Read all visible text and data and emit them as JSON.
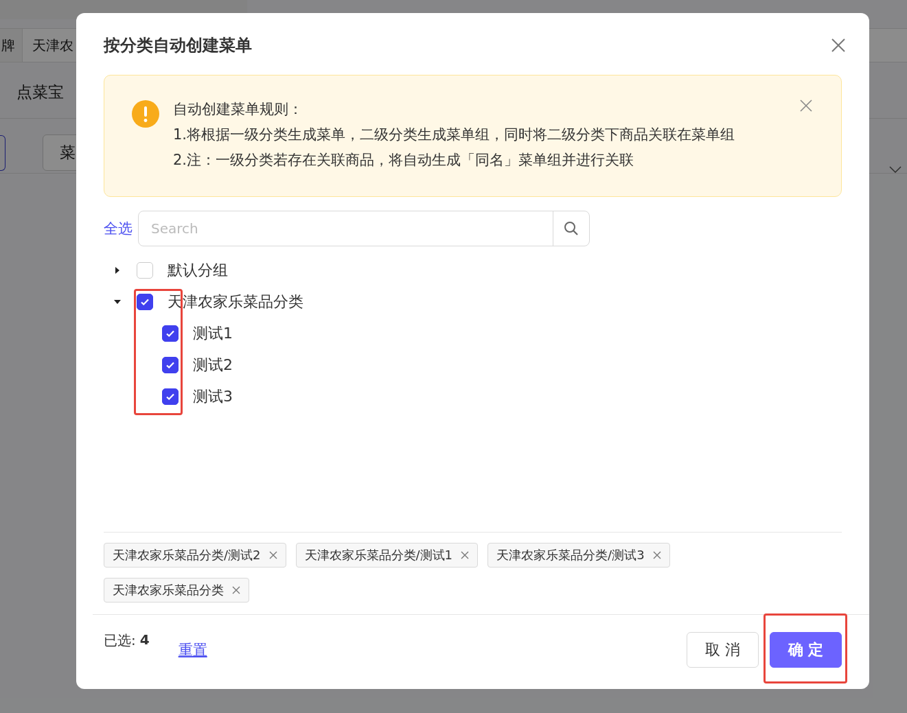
{
  "background": {
    "tabs": [
      "牌",
      "天津农"
    ],
    "brand": "点菜宝",
    "button": "菜"
  },
  "dialog": {
    "title": "按分类自动创建菜单",
    "alert": {
      "lines": [
        "自动创建菜单规则：",
        "1.将根据一级分类生成菜单，二级分类生成菜单组，同时将二级分类下商品关联在菜单组",
        "2.注：一级分类若存在关联商品，将自动生成「同名」菜单组并进行关联"
      ]
    },
    "select_all": "全选",
    "search": {
      "placeholder": "Search"
    },
    "tree": [
      {
        "label": "默认分组",
        "expanded": false,
        "checked": false
      },
      {
        "label": "天津农家乐菜品分类",
        "expanded": true,
        "checked": true,
        "children": [
          {
            "label": "测试1",
            "checked": true
          },
          {
            "label": "测试2",
            "checked": true
          },
          {
            "label": "测试3",
            "checked": true
          }
        ]
      }
    ],
    "tags": [
      "天津农家乐菜品分类/测试2",
      "天津农家乐菜品分类/测试1",
      "天津农家乐菜品分类/测试3",
      "天津农家乐菜品分类"
    ],
    "selected_label": "已选:",
    "selected_count": "4",
    "reset": "重置",
    "buttons": [
      {
        "label": "取 消",
        "kind": "default"
      },
      {
        "label": "确 定",
        "kind": "primary"
      }
    ]
  }
}
